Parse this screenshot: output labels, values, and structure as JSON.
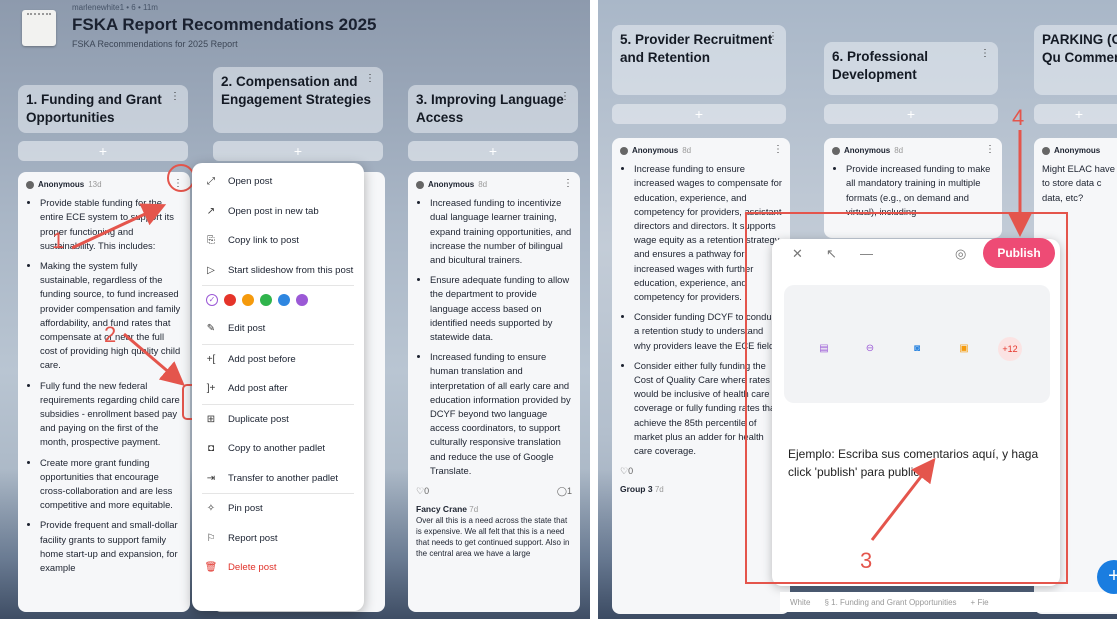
{
  "board": {
    "meta": "marlenewhite1 • 6 • 11m",
    "title": "FSKA Report Recommendations 2025",
    "subtitle": "FSKA Recommendations for 2025 Report"
  },
  "columns": {
    "c1": "1. Funding and Grant Opportunities",
    "c2": "2. Compensation and Engagement Strategies",
    "c3": "3. Improving Language Access",
    "c5": "5. Provider Recruitment and Retention",
    "c6": "6. Professional Development",
    "c7": "PARKING (Open Qu Comment"
  },
  "plus": "+",
  "post1": {
    "author": "Anonymous",
    "ago": "13d",
    "items": [
      "Provide stable funding for the entire ECE system to support its proper functioning and sustainability. This includes:",
      "Making the system fully sustainable, regardless of the funding source, to fund increased provider compensation and family affordability, and fund rates that compensate at or near the full cost of providing high quality child care.",
      "Fully fund the new federal requirements regarding child care subsidies - enrollment based pay and paying on the first of the month, prospective payment.",
      "Create more grant funding opportunities that encourage cross-collaboration and are less competitive and more equitable.",
      "Provide frequent and small-dollar facility grants to support family home start-up and expansion, for example"
    ]
  },
  "post3": {
    "author": "Anonymous",
    "ago": "8d",
    "items": [
      "Increased funding to incentivize dual language learner training, expand training opportunities, and increase the number of bilingual and bicultural trainers.",
      "Ensure adequate funding to allow the department to provide language access based on identified needs supported by statewide data.",
      "Increased funding to ensure human translation and interpretation of all early care and education information provided by DCYF beyond two language access coordinators, to support culturally responsive translation and reduce the use of Google Translate."
    ],
    "likes": "0",
    "comments": "1",
    "comment": {
      "name": "Fancy Crane",
      "ago": "7d",
      "text": "Over all this is a need across the state that is expensive. We all felt that this is a need that needs to get continued support. Also in the central area we have a large"
    }
  },
  "post5": {
    "author": "Anonymous",
    "ago": "8d",
    "items": [
      "Increase funding to ensure increased wages to compensate for education, experience, and competency for providers, assistant directors and directors. It supports wage equity as a retention strategy and ensures a pathway for increased wages with further education, experience, and competency for providers.",
      "Consider funding DCYF to conduct a retention study to understand why providers leave the ECE field.",
      "Consider either fully funding the Cost of Quality Care where rates would be inclusive of health care coverage or fully funding rates that achieve the 85th percentile of market plus an adder for health care coverage."
    ],
    "likes": "0",
    "group": "Group 3",
    "groupAgo": "7d"
  },
  "post6": {
    "author": "Anonymous",
    "ago": "8d",
    "items": [
      "Provide increased funding to make all mandatory training in multiple formats (e.g., on demand and virtual), including"
    ]
  },
  "post7": {
    "author": "Anonymous",
    "text": "Might ELAC have to store data c data, etc?"
  },
  "menu": {
    "open": "Open post",
    "open_tab": "Open post in new tab",
    "copy_link": "Copy link to post",
    "slideshow": "Start slideshow from this post",
    "edit": "Edit post",
    "add_before": "Add post before",
    "add_after": "Add post after",
    "duplicate": "Duplicate post",
    "copy_padlet": "Copy to another padlet",
    "transfer": "Transfer to another padlet",
    "pin": "Pin post",
    "report": "Report post",
    "delete": "Delete post"
  },
  "menu_colors": [
    "#ffffff",
    "#e5342a",
    "#f59a0c",
    "#30b44c",
    "#2e86e0",
    "#9b59d6"
  ],
  "composer": {
    "publish": "Publish",
    "more": "+12",
    "placeholder": "Ejemplo: Escriba sus comentarios aquí, y haga click 'publish' para publicar."
  },
  "bottombar": {
    "color": "White",
    "section": "§ 1. Funding and Grant Opportunities",
    "fields": "+ Fie"
  },
  "annotations": {
    "n1": "1",
    "n2": "2",
    "n3": "3",
    "n4": "4"
  },
  "accent": "#e4554c",
  "publish_color": "#ee4b75"
}
